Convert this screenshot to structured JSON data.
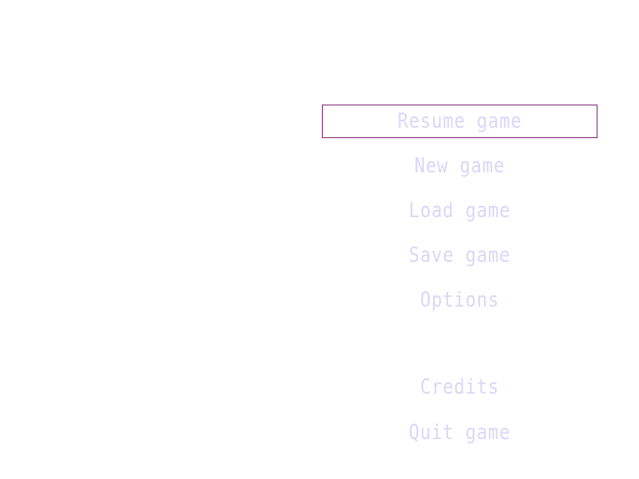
{
  "menu": {
    "items": [
      {
        "label": "Resume game",
        "selected": true
      },
      {
        "label": "New game",
        "selected": false
      },
      {
        "label": "Load game",
        "selected": false
      },
      {
        "label": "Save game",
        "selected": false
      },
      {
        "label": "Options",
        "selected": false
      },
      {
        "label": "Credits",
        "selected": false
      },
      {
        "label": "Quit game",
        "selected": false
      }
    ]
  },
  "colors": {
    "background": "#ffffff",
    "text": "#dcd6f7",
    "selection_border": "#7a1f6e"
  }
}
